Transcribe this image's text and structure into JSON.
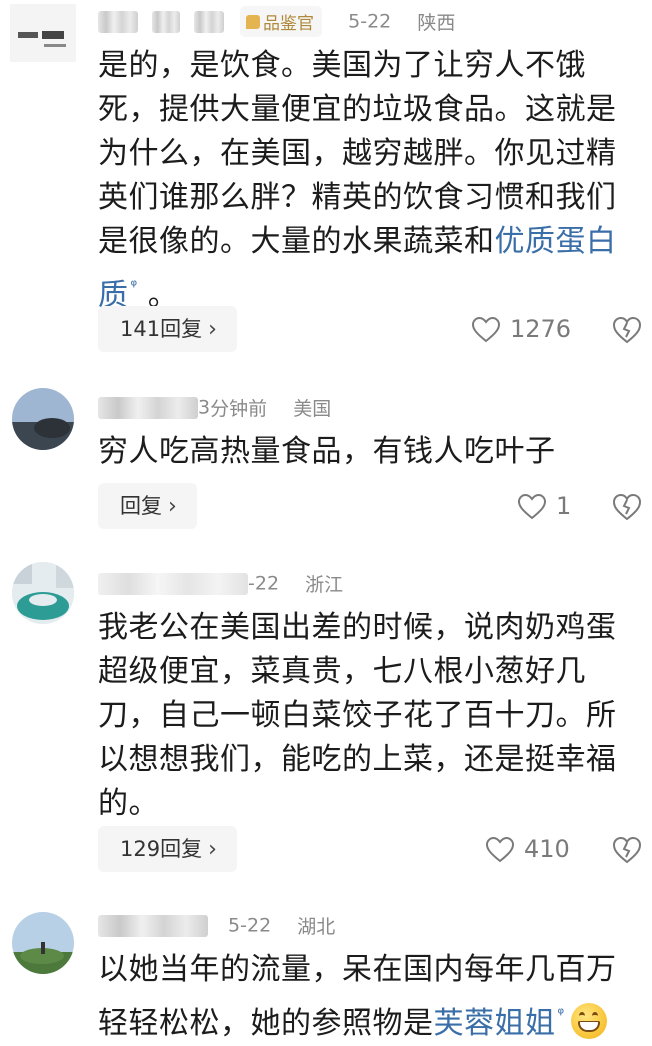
{
  "comments": [
    {
      "badge": "品鉴官",
      "date": "5-22",
      "location": "陕西",
      "lines": [
        "是的，是饮食。美国为了让穷人不饿",
        "死，提供大量便宜的垃圾食品。这就是",
        "为什么，在美国，越穷越胖。你见过精",
        "英们谁那么胖？精英的饮食习惯和我们",
        "是很像的。大量的水果蔬菜和"
      ],
      "link1": "优质蛋白",
      "link2": "质",
      "tail": " 。",
      "reply_label": "141回复",
      "likes": "1276"
    },
    {
      "name_partial": "3",
      "time": "分钟前",
      "location": "美国",
      "text": "穷人吃高热量食品，有钱人吃叶子",
      "reply_label": "回复",
      "likes": "1"
    },
    {
      "date": "-22",
      "location": "浙江",
      "lines": [
        "我老公在美国出差的时候，说肉奶鸡蛋",
        "超级便宜，菜真贵，七八根小葱好几",
        "刀，自己一顿白菜饺子花了百十刀。所",
        "以想想我们，能吃的上菜，还是挺幸福",
        "的。"
      ],
      "reply_label": "129回复",
      "likes": "410"
    },
    {
      "date": "5-22",
      "location": "湖北",
      "line1": "以她当年的流量，呆在国内每年几百万",
      "line2": "轻轻松松，她的参照物是",
      "link": "芙蓉姐姐"
    }
  ],
  "icons": {
    "like": "heart-outline-icon",
    "dislike": "broken-heart-icon",
    "search": "search-icon",
    "chevron": "chevron-right-icon",
    "emoji": "grin-emoji-icon"
  },
  "colors": {
    "link": "#3a6ea8",
    "badge": "#b08a3c",
    "meta": "#8a8a8a"
  }
}
